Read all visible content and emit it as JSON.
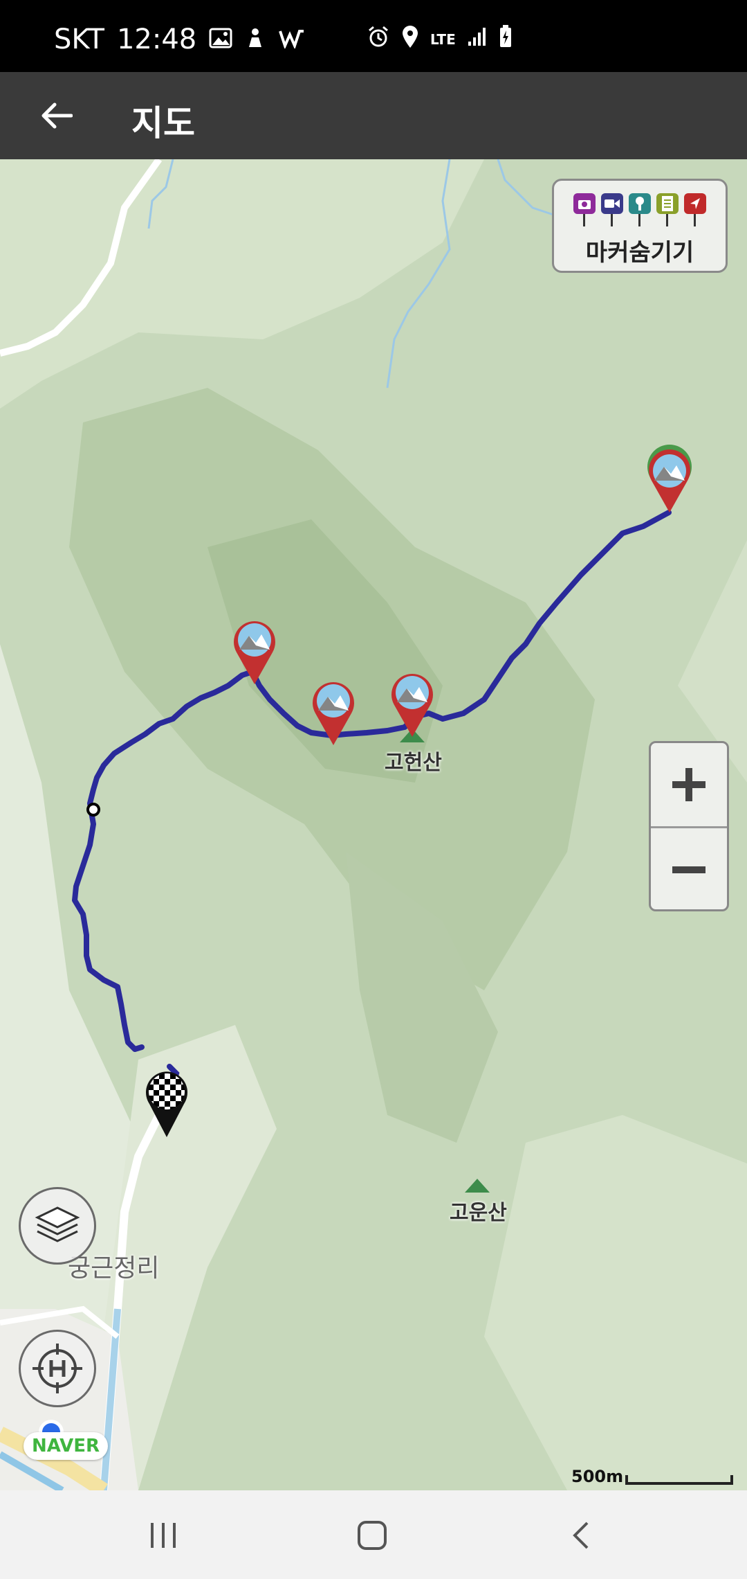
{
  "status_bar": {
    "carrier": "SKT",
    "time": "12:48",
    "network": "LTE"
  },
  "app_bar": {
    "back_icon": "arrow-left-icon",
    "title": "지도"
  },
  "map": {
    "marker_toggle": {
      "label": "마커숨기기",
      "icons": [
        {
          "name": "camera-marker-icon",
          "color": "#8e2a9a"
        },
        {
          "name": "video-marker-icon",
          "color": "#3a3a8a"
        },
        {
          "name": "voice-marker-icon",
          "color": "#2a8a8a"
        },
        {
          "name": "memo-marker-icon",
          "color": "#8aa02a"
        },
        {
          "name": "poi-marker-icon",
          "color": "#c02a2a"
        }
      ]
    },
    "zoom": {
      "in": "+",
      "out": "−"
    },
    "places": {
      "peak1": "고헌산",
      "peak2": "고운산",
      "village": "궁근정리"
    },
    "route_color": "#2a2a9a",
    "attribution": "NAVER",
    "scale": "500m"
  },
  "nav_bar": {
    "recents_icon": "recents-icon",
    "home_icon": "home-icon",
    "back_icon": "back-icon"
  }
}
